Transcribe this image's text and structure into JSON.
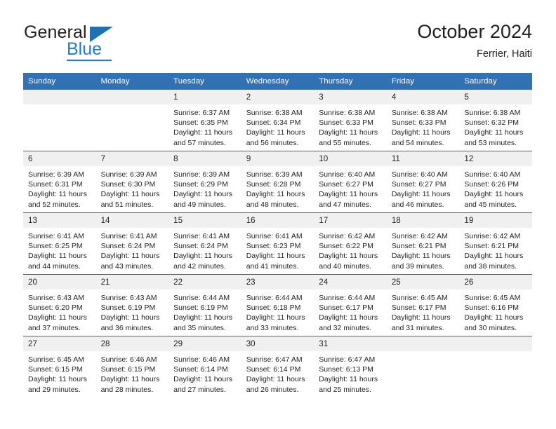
{
  "logo": {
    "line1": "General",
    "line2": "Blue",
    "brand_color": "#1f7ec4",
    "triangle_color": "#1f6fb5",
    "triangle_icon": "triangle-icon"
  },
  "header": {
    "title": "October 2024",
    "subtitle": "Ferrier, Haiti"
  },
  "theme": {
    "header_blue": "#3272b4",
    "rule_blue": "#2e6da8",
    "daynum_bg": "#f0f0f0",
    "text": "#231f20"
  },
  "weekdays": [
    "Sunday",
    "Monday",
    "Tuesday",
    "Wednesday",
    "Thursday",
    "Friday",
    "Saturday"
  ],
  "weeks": [
    [
      {
        "day": "",
        "lines": []
      },
      {
        "day": "",
        "lines": []
      },
      {
        "day": "1",
        "lines": [
          "Sunrise: 6:37 AM",
          "Sunset: 6:35 PM",
          "Daylight: 11 hours",
          "and 57 minutes."
        ]
      },
      {
        "day": "2",
        "lines": [
          "Sunrise: 6:38 AM",
          "Sunset: 6:34 PM",
          "Daylight: 11 hours",
          "and 56 minutes."
        ]
      },
      {
        "day": "3",
        "lines": [
          "Sunrise: 6:38 AM",
          "Sunset: 6:33 PM",
          "Daylight: 11 hours",
          "and 55 minutes."
        ]
      },
      {
        "day": "4",
        "lines": [
          "Sunrise: 6:38 AM",
          "Sunset: 6:33 PM",
          "Daylight: 11 hours",
          "and 54 minutes."
        ]
      },
      {
        "day": "5",
        "lines": [
          "Sunrise: 6:38 AM",
          "Sunset: 6:32 PM",
          "Daylight: 11 hours",
          "and 53 minutes."
        ]
      }
    ],
    [
      {
        "day": "6",
        "lines": [
          "Sunrise: 6:39 AM",
          "Sunset: 6:31 PM",
          "Daylight: 11 hours",
          "and 52 minutes."
        ]
      },
      {
        "day": "7",
        "lines": [
          "Sunrise: 6:39 AM",
          "Sunset: 6:30 PM",
          "Daylight: 11 hours",
          "and 51 minutes."
        ]
      },
      {
        "day": "8",
        "lines": [
          "Sunrise: 6:39 AM",
          "Sunset: 6:29 PM",
          "Daylight: 11 hours",
          "and 49 minutes."
        ]
      },
      {
        "day": "9",
        "lines": [
          "Sunrise: 6:39 AM",
          "Sunset: 6:28 PM",
          "Daylight: 11 hours",
          "and 48 minutes."
        ]
      },
      {
        "day": "10",
        "lines": [
          "Sunrise: 6:40 AM",
          "Sunset: 6:27 PM",
          "Daylight: 11 hours",
          "and 47 minutes."
        ]
      },
      {
        "day": "11",
        "lines": [
          "Sunrise: 6:40 AM",
          "Sunset: 6:27 PM",
          "Daylight: 11 hours",
          "and 46 minutes."
        ]
      },
      {
        "day": "12",
        "lines": [
          "Sunrise: 6:40 AM",
          "Sunset: 6:26 PM",
          "Daylight: 11 hours",
          "and 45 minutes."
        ]
      }
    ],
    [
      {
        "day": "13",
        "lines": [
          "Sunrise: 6:41 AM",
          "Sunset: 6:25 PM",
          "Daylight: 11 hours",
          "and 44 minutes."
        ]
      },
      {
        "day": "14",
        "lines": [
          "Sunrise: 6:41 AM",
          "Sunset: 6:24 PM",
          "Daylight: 11 hours",
          "and 43 minutes."
        ]
      },
      {
        "day": "15",
        "lines": [
          "Sunrise: 6:41 AM",
          "Sunset: 6:24 PM",
          "Daylight: 11 hours",
          "and 42 minutes."
        ]
      },
      {
        "day": "16",
        "lines": [
          "Sunrise: 6:41 AM",
          "Sunset: 6:23 PM",
          "Daylight: 11 hours",
          "and 41 minutes."
        ]
      },
      {
        "day": "17",
        "lines": [
          "Sunrise: 6:42 AM",
          "Sunset: 6:22 PM",
          "Daylight: 11 hours",
          "and 40 minutes."
        ]
      },
      {
        "day": "18",
        "lines": [
          "Sunrise: 6:42 AM",
          "Sunset: 6:21 PM",
          "Daylight: 11 hours",
          "and 39 minutes."
        ]
      },
      {
        "day": "19",
        "lines": [
          "Sunrise: 6:42 AM",
          "Sunset: 6:21 PM",
          "Daylight: 11 hours",
          "and 38 minutes."
        ]
      }
    ],
    [
      {
        "day": "20",
        "lines": [
          "Sunrise: 6:43 AM",
          "Sunset: 6:20 PM",
          "Daylight: 11 hours",
          "and 37 minutes."
        ]
      },
      {
        "day": "21",
        "lines": [
          "Sunrise: 6:43 AM",
          "Sunset: 6:19 PM",
          "Daylight: 11 hours",
          "and 36 minutes."
        ]
      },
      {
        "day": "22",
        "lines": [
          "Sunrise: 6:44 AM",
          "Sunset: 6:19 PM",
          "Daylight: 11 hours",
          "and 35 minutes."
        ]
      },
      {
        "day": "23",
        "lines": [
          "Sunrise: 6:44 AM",
          "Sunset: 6:18 PM",
          "Daylight: 11 hours",
          "and 33 minutes."
        ]
      },
      {
        "day": "24",
        "lines": [
          "Sunrise: 6:44 AM",
          "Sunset: 6:17 PM",
          "Daylight: 11 hours",
          "and 32 minutes."
        ]
      },
      {
        "day": "25",
        "lines": [
          "Sunrise: 6:45 AM",
          "Sunset: 6:17 PM",
          "Daylight: 11 hours",
          "and 31 minutes."
        ]
      },
      {
        "day": "26",
        "lines": [
          "Sunrise: 6:45 AM",
          "Sunset: 6:16 PM",
          "Daylight: 11 hours",
          "and 30 minutes."
        ]
      }
    ],
    [
      {
        "day": "27",
        "lines": [
          "Sunrise: 6:45 AM",
          "Sunset: 6:15 PM",
          "Daylight: 11 hours",
          "and 29 minutes."
        ]
      },
      {
        "day": "28",
        "lines": [
          "Sunrise: 6:46 AM",
          "Sunset: 6:15 PM",
          "Daylight: 11 hours",
          "and 28 minutes."
        ]
      },
      {
        "day": "29",
        "lines": [
          "Sunrise: 6:46 AM",
          "Sunset: 6:14 PM",
          "Daylight: 11 hours",
          "and 27 minutes."
        ]
      },
      {
        "day": "30",
        "lines": [
          "Sunrise: 6:47 AM",
          "Sunset: 6:14 PM",
          "Daylight: 11 hours",
          "and 26 minutes."
        ]
      },
      {
        "day": "31",
        "lines": [
          "Sunrise: 6:47 AM",
          "Sunset: 6:13 PM",
          "Daylight: 11 hours",
          "and 25 minutes."
        ]
      },
      {
        "day": "",
        "lines": []
      },
      {
        "day": "",
        "lines": []
      }
    ]
  ]
}
